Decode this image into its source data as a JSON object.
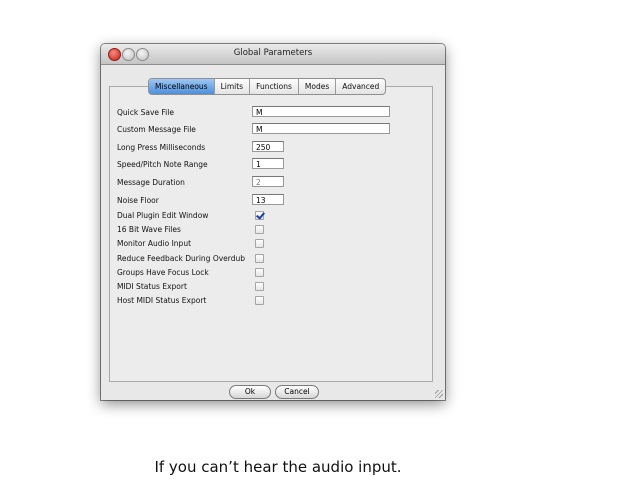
{
  "window": {
    "title": "Global Parameters"
  },
  "tabs": [
    {
      "label": "Miscellaneous",
      "selected": true
    },
    {
      "label": "Limits",
      "selected": false
    },
    {
      "label": "Functions",
      "selected": false
    },
    {
      "label": "Modes",
      "selected": false
    },
    {
      "label": "Advanced",
      "selected": false
    }
  ],
  "fields": {
    "quick_save_file": {
      "label": "Quick Save File",
      "value": "M"
    },
    "custom_message_file": {
      "label": "Custom Message File",
      "value": "M"
    },
    "long_press_ms": {
      "label": "Long Press Milliseconds",
      "value": "250"
    },
    "speed_pitch_range": {
      "label": "Speed/Pitch Note Range",
      "value": "1"
    },
    "message_duration": {
      "label": "Message Duration",
      "value": "2"
    },
    "noise_floor": {
      "label": "Noise Floor",
      "value": "13"
    }
  },
  "checkboxes": {
    "dual_plugin_edit_window": {
      "label": "Dual Plugin Edit Window",
      "checked": true
    },
    "bit16_wave_files": {
      "label": "16 Bit Wave Files",
      "checked": false
    },
    "monitor_audio_input": {
      "label": "Monitor Audio Input",
      "checked": false
    },
    "reduce_feedback_overdub": {
      "label": "Reduce Feedback During Overdub",
      "checked": false
    },
    "groups_focus_lock": {
      "label": "Groups Have Focus Lock",
      "checked": false
    },
    "midi_status_export": {
      "label": "MIDI Status Export",
      "checked": false
    },
    "host_midi_status_export": {
      "label": "Host MIDI Status Export",
      "checked": false
    }
  },
  "buttons": {
    "ok": "Ok",
    "cancel": "Cancel"
  },
  "caption": "If you can’t hear the audio input."
}
